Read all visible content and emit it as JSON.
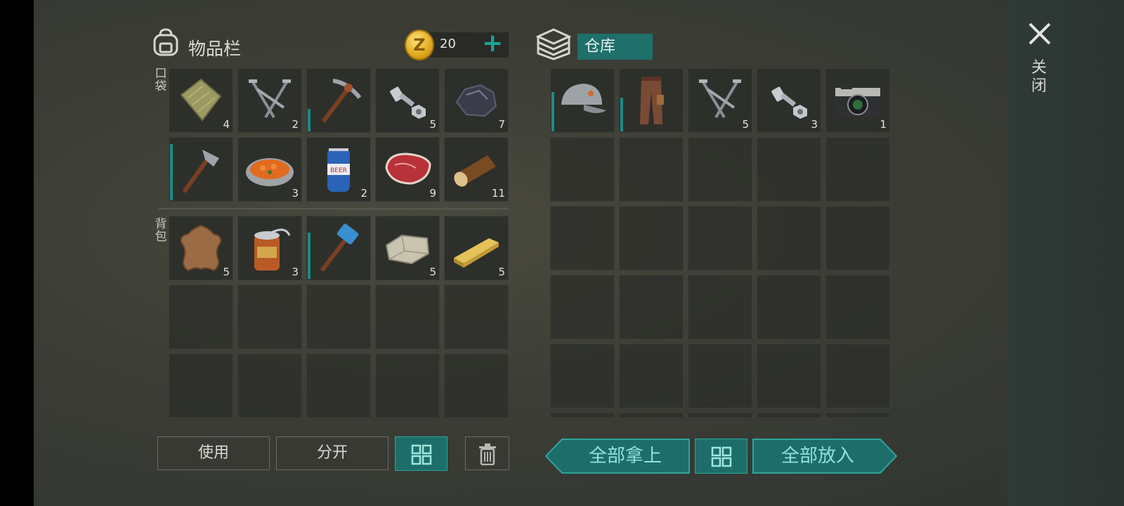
{
  "inventory": {
    "title": "物品栏",
    "coins": "20",
    "coin_symbol": "Z",
    "add_symbol": "+",
    "pocket_label": "口袋",
    "backpack_label": "背包",
    "pocket": [
      {
        "icon": "cloth-icon",
        "count": "4"
      },
      {
        "icon": "nails-icon",
        "count": "2"
      },
      {
        "icon": "pickaxe-icon",
        "count": "",
        "durability": 0.35
      },
      {
        "icon": "bolt-nut-icon",
        "count": "5"
      },
      {
        "icon": "coal-icon",
        "count": "7"
      },
      {
        "icon": "hatchet-icon",
        "count": "",
        "durability": 0.85
      },
      {
        "icon": "cooked-stew-icon",
        "count": "3"
      },
      {
        "icon": "beer-can-icon",
        "count": "2"
      },
      {
        "icon": "raw-meat-icon",
        "count": "9"
      },
      {
        "icon": "log-icon",
        "count": "11"
      }
    ],
    "backpack": [
      {
        "icon": "hide-icon",
        "count": "5"
      },
      {
        "icon": "canned-food-icon",
        "count": "3"
      },
      {
        "icon": "sledgehammer-icon",
        "count": "",
        "durability": 0.7
      },
      {
        "icon": "stone-icon",
        "count": "5"
      },
      {
        "icon": "plank-icon",
        "count": "5"
      }
    ]
  },
  "storage": {
    "title": "仓库",
    "items": [
      {
        "icon": "cap-icon",
        "count": "",
        "durability": 0.6
      },
      {
        "icon": "pants-icon",
        "count": "",
        "durability": 0.5
      },
      {
        "icon": "nails-icon",
        "count": "5"
      },
      {
        "icon": "bolt-nut-icon",
        "count": "3"
      },
      {
        "icon": "camera-icon",
        "count": "1"
      }
    ]
  },
  "buttons": {
    "use": "使用",
    "split": "分开",
    "take_all": "全部拿上",
    "put_all": "全部放入"
  },
  "close_label": "关闭",
  "colors": {
    "accent": "#1d6e6a",
    "accent_light": "#2ea39c",
    "durability": "#1b8c86"
  }
}
